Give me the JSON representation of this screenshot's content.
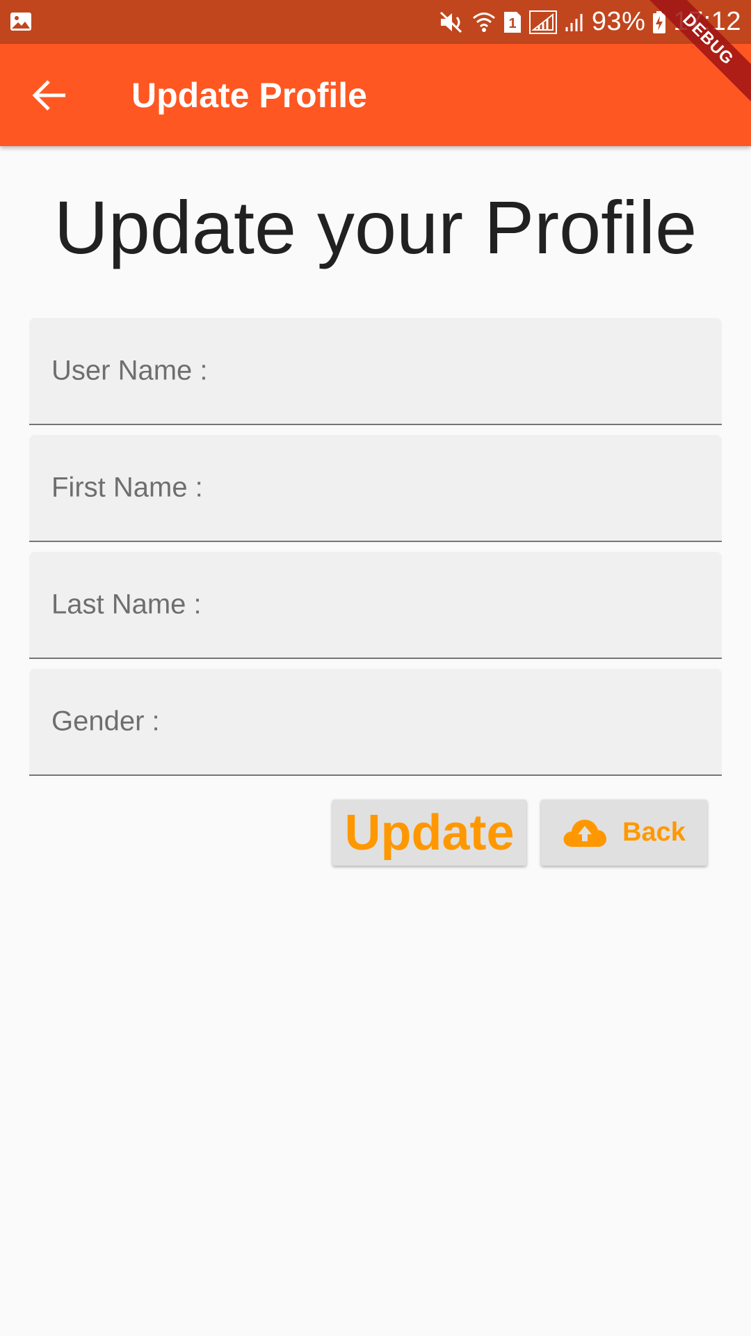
{
  "status_bar": {
    "battery": "93%",
    "time": "17:12",
    "sim_slot": "1",
    "icons": [
      "gallery-icon",
      "mute-icon",
      "wifi-icon",
      "sim-icon",
      "signal-icon",
      "signal-icon",
      "battery-charging-icon"
    ]
  },
  "app_bar": {
    "title": "Update Profile",
    "back_icon": "arrow-back-icon",
    "background": "#ff5722"
  },
  "debug_banner": "DEBUG",
  "heading": "Update your Profile",
  "form": {
    "fields": [
      {
        "label": "User Name :",
        "value": ""
      },
      {
        "label": "First Name :",
        "value": ""
      },
      {
        "label": "Last Name :",
        "value": ""
      },
      {
        "label": "Gender :",
        "value": ""
      }
    ]
  },
  "buttons": {
    "update_label": "Update",
    "back_label": "Back",
    "back_icon": "cloud-upload-icon",
    "accent": "#ff9800"
  }
}
